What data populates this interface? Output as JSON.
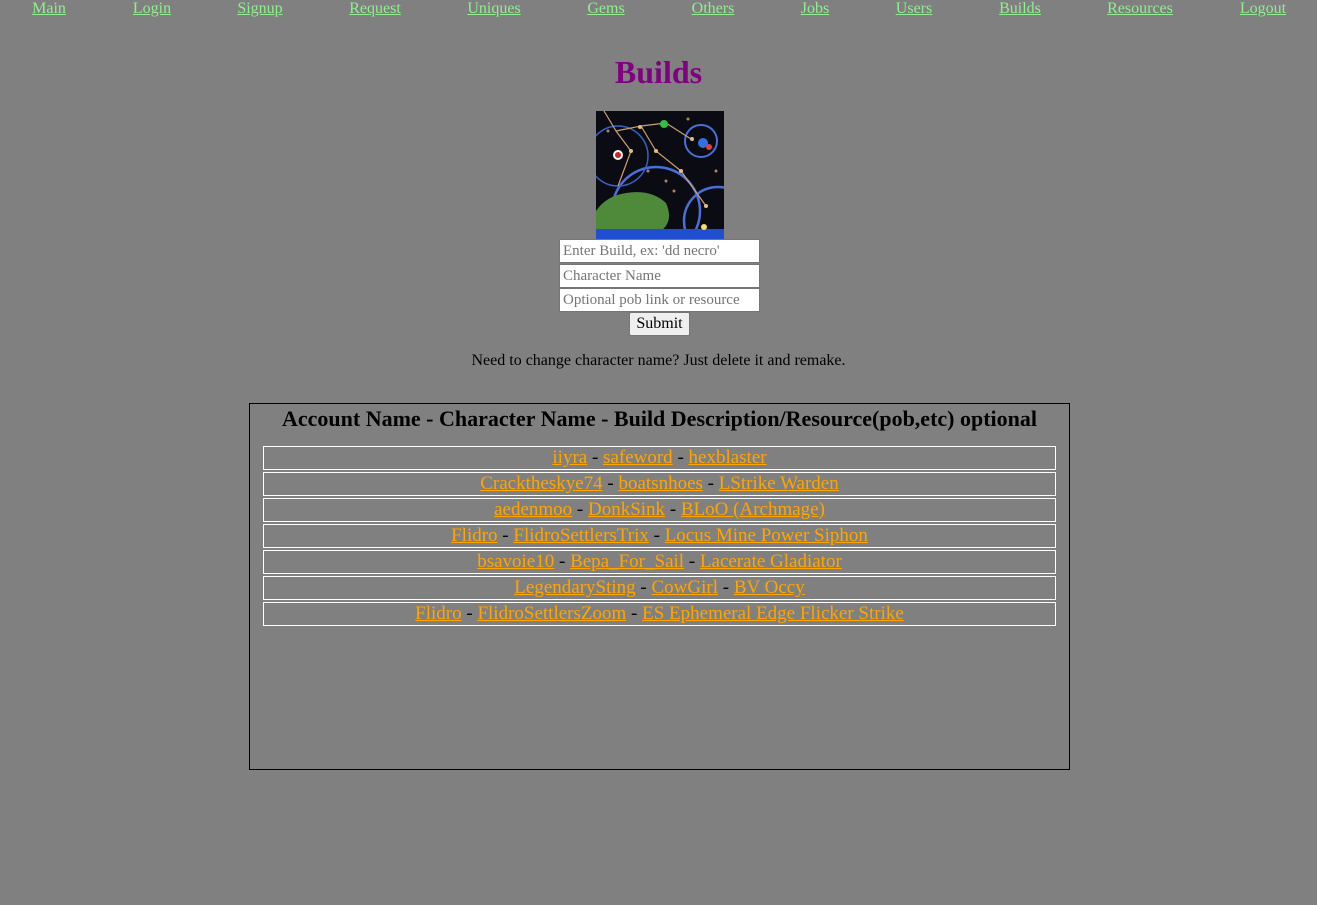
{
  "nav": [
    "Main",
    "Login",
    "Signup",
    "Request",
    "Uniques",
    "Gems",
    "Others",
    "Jobs",
    "Users",
    "Builds",
    "Resources",
    "Logout"
  ],
  "page": {
    "title": "Builds"
  },
  "form": {
    "build_placeholder": "Enter Build, ex: 'dd necro'",
    "character_placeholder": "Character Name",
    "pob_placeholder": "Optional pob link or resource",
    "submit_label": "Submit"
  },
  "hint": "Need to change character name? Just delete it and remake.",
  "builds": {
    "header": "Account Name - Character Name - Build Description/Resource(pob,etc) optional",
    "separator": "-",
    "rows": [
      {
        "account": "iiyra",
        "character": "safeword",
        "build": "hexblaster"
      },
      {
        "account": "Cracktheskye74",
        "character": "boatsnhoes",
        "build": "LStrike Warden"
      },
      {
        "account": "aedenmoo",
        "character": "DonkSink",
        "build": "BLoO (Archmage)"
      },
      {
        "account": "Flidro",
        "character": "FlidroSettlersTrix",
        "build": "Locus Mine Power Siphon"
      },
      {
        "account": "bsavoie10",
        "character": "Bepa_For_Sail",
        "build": "Lacerate Gladiator"
      },
      {
        "account": "LegendarySting",
        "character": "CowGirl",
        "build": "BV Occy"
      },
      {
        "account": "Flidro",
        "character": "FlidroSettlersZoom",
        "build": "ES Ephemeral Edge Flicker Strike"
      }
    ]
  },
  "colors": {
    "background": "#808080",
    "nav_link": "#90ee90",
    "title": "#800080",
    "build_link": "#ffa500"
  }
}
